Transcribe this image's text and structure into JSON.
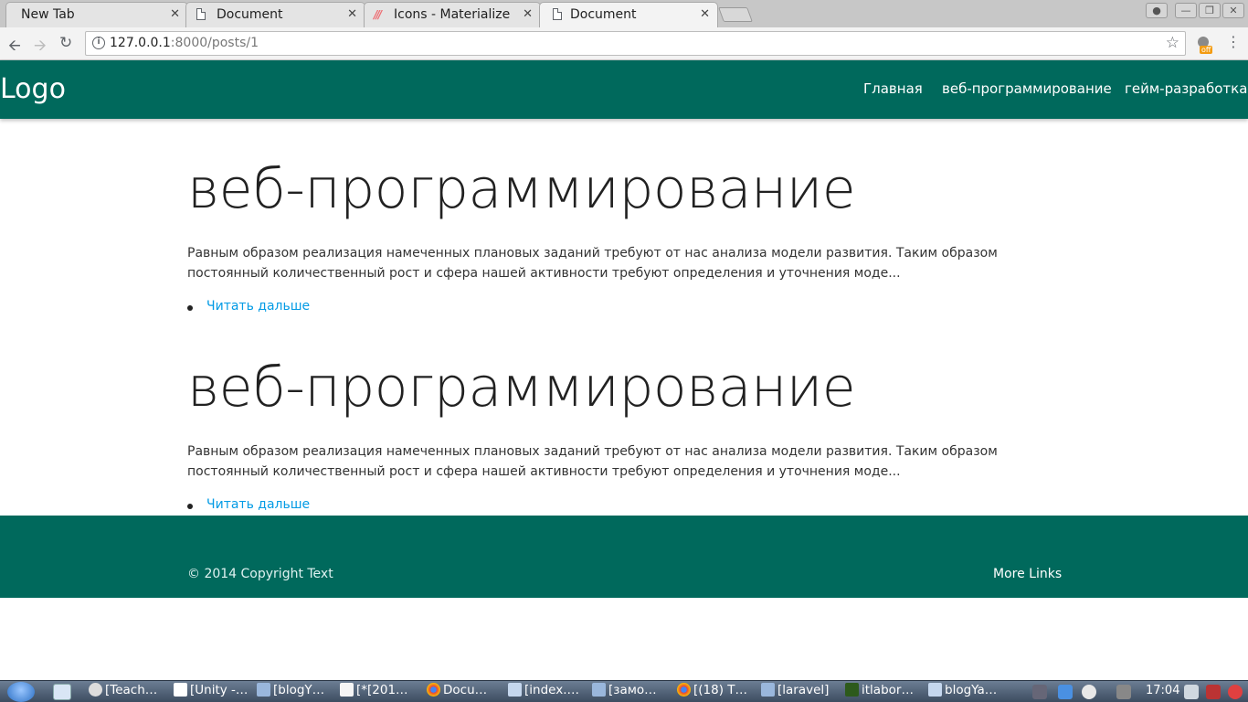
{
  "browser": {
    "tabs": [
      {
        "title": "New Tab"
      },
      {
        "title": "Document"
      },
      {
        "title": "Icons - Materialize"
      },
      {
        "title": "Document"
      }
    ],
    "close_glyph": "✕",
    "url_host": "127.0.0.1",
    "url_path": ":8000/posts/1",
    "extension_badge": "off"
  },
  "navbar": {
    "logo": "Logo",
    "links": [
      "Главная",
      "веб-программирование",
      "гейм-разработка"
    ]
  },
  "posts": [
    {
      "title": "веб-программирование",
      "excerpt": "Равным образом реализация намеченных плановых заданий требуют от нас анализа модели развития. Таким образом постоянный количественный рост и сфера нашей активности требуют определения и уточнения моде...",
      "read_more": "Читать дальше"
    },
    {
      "title": "веб-программирование",
      "excerpt": "Равным образом реализация намеченных плановых заданий требуют от нас анализа модели развития. Таким образом постоянный количественный рост и сфера нашей активности требуют определения и уточнения моде...",
      "read_more": "Читать дальше"
    }
  ],
  "footer": {
    "copyright": "© 2014 Copyright Text",
    "more_links": "More Links"
  },
  "taskbar": {
    "items": [
      "[Teach…",
      "[Unity -…",
      "[blogY…",
      "[*[201…",
      "Docu…",
      "[index.…",
      "[замо…",
      "[(18) T…",
      "[laravel]",
      "itlabor…",
      "blogYa…"
    ],
    "clock": "17:04"
  }
}
